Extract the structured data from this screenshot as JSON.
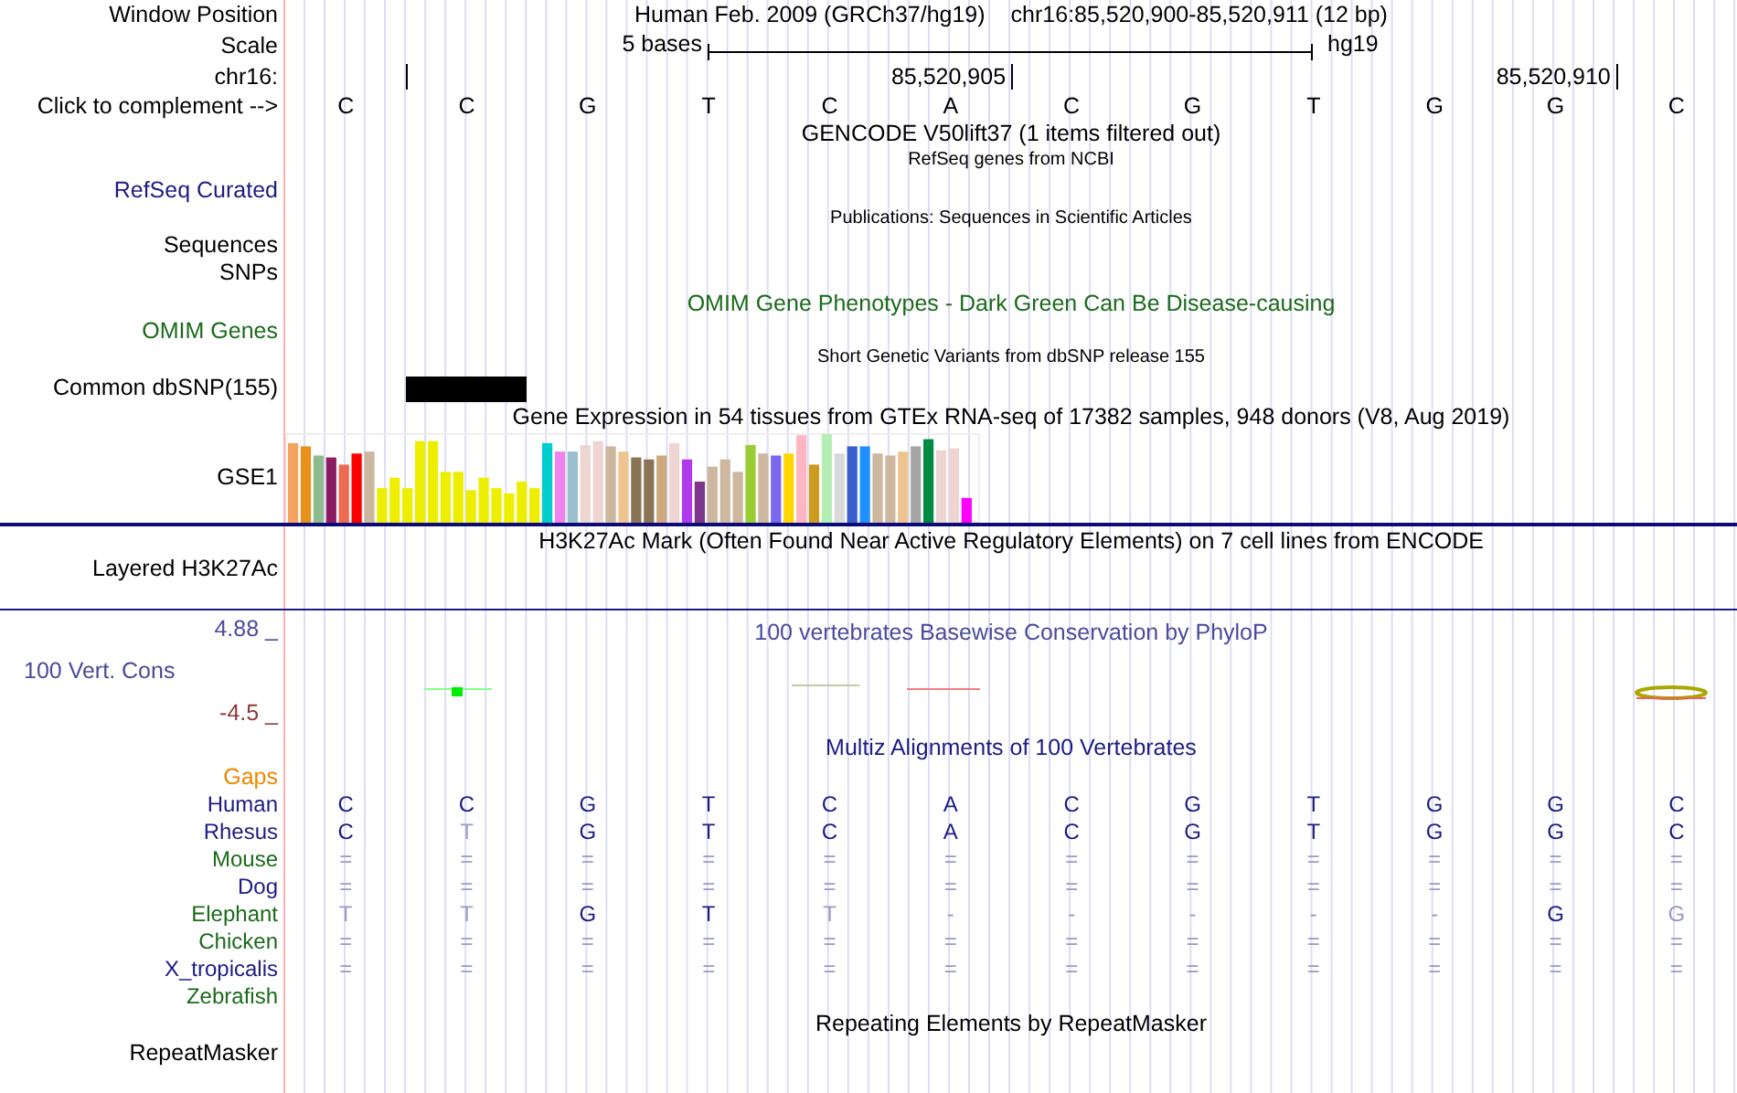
{
  "header": {
    "position_label": "Window Position",
    "assembly": "Human Feb. 2009 (GRCh37/hg19)",
    "position": "chr16:85,520,900-85,520,911 (12 bp)",
    "scale_label": "Scale",
    "scale_text": "5 bases",
    "scale_assembly": "hg19",
    "chrom_label": "chr16:",
    "coordinate_ticks": [
      "85,520,905",
      "85,520,910"
    ],
    "complement_label": "Click to complement -->",
    "bases": [
      "C",
      "C",
      "G",
      "T",
      "C",
      "A",
      "C",
      "G",
      "T",
      "G",
      "G",
      "C"
    ]
  },
  "tracks": [
    {
      "kind": "gencode",
      "title": "GENCODE V50lift37 (1 items filtered out)"
    },
    {
      "kind": "refseq",
      "title": "RefSeq genes from NCBI",
      "label": "RefSeq Curated"
    },
    {
      "kind": "publications",
      "title": "Publications: Sequences in Scientific Articles",
      "labels": [
        "Sequences",
        "SNPs"
      ]
    },
    {
      "kind": "omim",
      "title": "OMIM Gene Phenotypes - Dark Green Can Be Disease-causing",
      "label": "OMIM Genes"
    },
    {
      "kind": "dbsnp",
      "title": "Short Genetic Variants from dbSNP release 155",
      "label": "Common dbSNP(155)"
    },
    {
      "kind": "gtex",
      "title": "Gene Expression in 54 tissues from GTEx RNA-seq of 17382 samples, 948 donors (V8, Aug 2019)",
      "label": "GSE1"
    },
    {
      "kind": "h3k27ac",
      "title": "H3K27Ac Mark (Often Found Near Active Regulatory Elements) on 7 cell lines from ENCODE",
      "label": "Layered H3K27Ac"
    },
    {
      "kind": "conservation",
      "title": "100 vertebrates Basewise Conservation by PhyloP",
      "label": "100 Vert. Cons",
      "max": "4.88 _",
      "min": "-4.5 _"
    },
    {
      "kind": "multiz",
      "title": "Multiz Alignments of 100 Vertebrates",
      "gaps_label": "Gaps",
      "species": [
        {
          "name": "Human",
          "color": "#1c1c84",
          "bases": [
            {
              "base": "C",
              "dim": false
            },
            {
              "base": "C",
              "dim": false
            },
            {
              "base": "G",
              "dim": false
            },
            {
              "base": "T",
              "dim": false
            },
            {
              "base": "C",
              "dim": false
            },
            {
              "base": "A",
              "dim": false
            },
            {
              "base": "C",
              "dim": false
            },
            {
              "base": "G",
              "dim": false
            },
            {
              "base": "T",
              "dim": false
            },
            {
              "base": "G",
              "dim": false
            },
            {
              "base": "G",
              "dim": false
            },
            {
              "base": "C",
              "dim": false
            }
          ]
        },
        {
          "name": "Rhesus",
          "color": "#1c1c84",
          "bases": [
            {
              "base": "C",
              "dim": false
            },
            {
              "base": "T",
              "dim": true
            },
            {
              "base": "G",
              "dim": false
            },
            {
              "base": "T",
              "dim": false
            },
            {
              "base": "C",
              "dim": false
            },
            {
              "base": "A",
              "dim": false
            },
            {
              "base": "C",
              "dim": false
            },
            {
              "base": "G",
              "dim": false
            },
            {
              "base": "T",
              "dim": false
            },
            {
              "base": "G",
              "dim": false
            },
            {
              "base": "G",
              "dim": false
            },
            {
              "base": "C",
              "dim": false
            }
          ]
        },
        {
          "name": "Mouse",
          "color": "#1b6b1b",
          "bases": [
            {
              "base": "=",
              "dim": true
            },
            {
              "base": "=",
              "dim": true
            },
            {
              "base": "=",
              "dim": true
            },
            {
              "base": "=",
              "dim": true
            },
            {
              "base": "=",
              "dim": true
            },
            {
              "base": "=",
              "dim": true
            },
            {
              "base": "=",
              "dim": true
            },
            {
              "base": "=",
              "dim": true
            },
            {
              "base": "=",
              "dim": true
            },
            {
              "base": "=",
              "dim": true
            },
            {
              "base": "=",
              "dim": true
            },
            {
              "base": "=",
              "dim": true
            }
          ]
        },
        {
          "name": "Dog",
          "color": "#1c1c84",
          "bases": [
            {
              "base": "=",
              "dim": true
            },
            {
              "base": "=",
              "dim": true
            },
            {
              "base": "=",
              "dim": true
            },
            {
              "base": "=",
              "dim": true
            },
            {
              "base": "=",
              "dim": true
            },
            {
              "base": "=",
              "dim": true
            },
            {
              "base": "=",
              "dim": true
            },
            {
              "base": "=",
              "dim": true
            },
            {
              "base": "=",
              "dim": true
            },
            {
              "base": "=",
              "dim": true
            },
            {
              "base": "=",
              "dim": true
            },
            {
              "base": "=",
              "dim": true
            }
          ]
        },
        {
          "name": "Elephant",
          "color": "#1b6b1b",
          "bases": [
            {
              "base": "T",
              "dim": true
            },
            {
              "base": "T",
              "dim": true
            },
            {
              "base": "G",
              "dim": false
            },
            {
              "base": "T",
              "dim": false
            },
            {
              "base": "T",
              "dim": true
            },
            {
              "base": "-",
              "dim": true
            },
            {
              "base": "-",
              "dim": true
            },
            {
              "base": "-",
              "dim": true
            },
            {
              "base": "-",
              "dim": true
            },
            {
              "base": "-",
              "dim": true
            },
            {
              "base": "G",
              "dim": false
            },
            {
              "base": "G",
              "dim": true
            }
          ]
        },
        {
          "name": "Chicken",
          "color": "#1b6b1b",
          "bases": [
            {
              "base": "=",
              "dim": true
            },
            {
              "base": "=",
              "dim": true
            },
            {
              "base": "=",
              "dim": true
            },
            {
              "base": "=",
              "dim": true
            },
            {
              "base": "=",
              "dim": true
            },
            {
              "base": "=",
              "dim": true
            },
            {
              "base": "=",
              "dim": true
            },
            {
              "base": "=",
              "dim": true
            },
            {
              "base": "=",
              "dim": true
            },
            {
              "base": "=",
              "dim": true
            },
            {
              "base": "=",
              "dim": true
            },
            {
              "base": "=",
              "dim": true
            }
          ]
        },
        {
          "name": "X_tropicalis",
          "color": "#1c1c84",
          "bases": [
            {
              "base": "=",
              "dim": true
            },
            {
              "base": "=",
              "dim": true
            },
            {
              "base": "=",
              "dim": true
            },
            {
              "base": "=",
              "dim": true
            },
            {
              "base": "=",
              "dim": true
            },
            {
              "base": "=",
              "dim": true
            },
            {
              "base": "=",
              "dim": true
            },
            {
              "base": "=",
              "dim": true
            },
            {
              "base": "=",
              "dim": true
            },
            {
              "base": "=",
              "dim": true
            },
            {
              "base": "=",
              "dim": true
            },
            {
              "base": "=",
              "dim": true
            }
          ]
        },
        {
          "name": "Zebrafish",
          "color": "#1b6b1b"
        }
      ]
    },
    {
      "kind": "repeatmasker",
      "title": "Repeating Elements by RepeatMasker",
      "label": "RepeatMasker"
    }
  ]
}
